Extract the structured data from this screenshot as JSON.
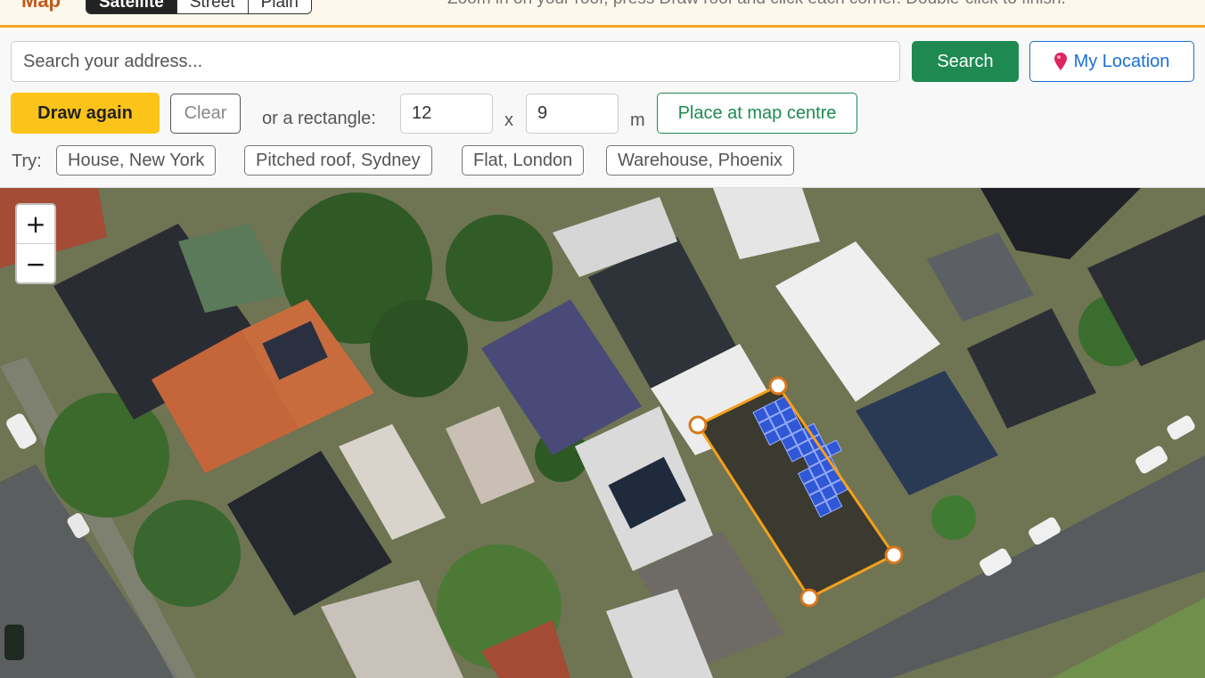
{
  "header": {
    "title": "Map",
    "map_modes": [
      {
        "label": "Satellite",
        "active": true
      },
      {
        "label": "Street",
        "active": false
      },
      {
        "label": "Plain",
        "active": false
      }
    ],
    "hint": "Zoom in on your roof, press Draw roof and click each corner. Double-click to finish."
  },
  "search": {
    "placeholder": "Search your address...",
    "value": "",
    "search_label": "Search",
    "my_location_label": "My Location",
    "my_location_icon": "pin-icon"
  },
  "draw": {
    "draw_label": "Draw again",
    "clear_label": "Clear",
    "rect_label": "or a rectangle:",
    "width_value": "12",
    "times": "x",
    "height_value": "9",
    "unit": "m",
    "place_label": "Place at map centre"
  },
  "examples": {
    "label": "Try:",
    "chips": [
      "House, New York",
      "Pitched roof, Sydney",
      "Flat, London",
      "Warehouse, Phoenix"
    ]
  },
  "map": {
    "zoom_in": "+",
    "zoom_out": "−",
    "outline_color": "#f5a01a",
    "panel_color": "#2f57d6"
  }
}
